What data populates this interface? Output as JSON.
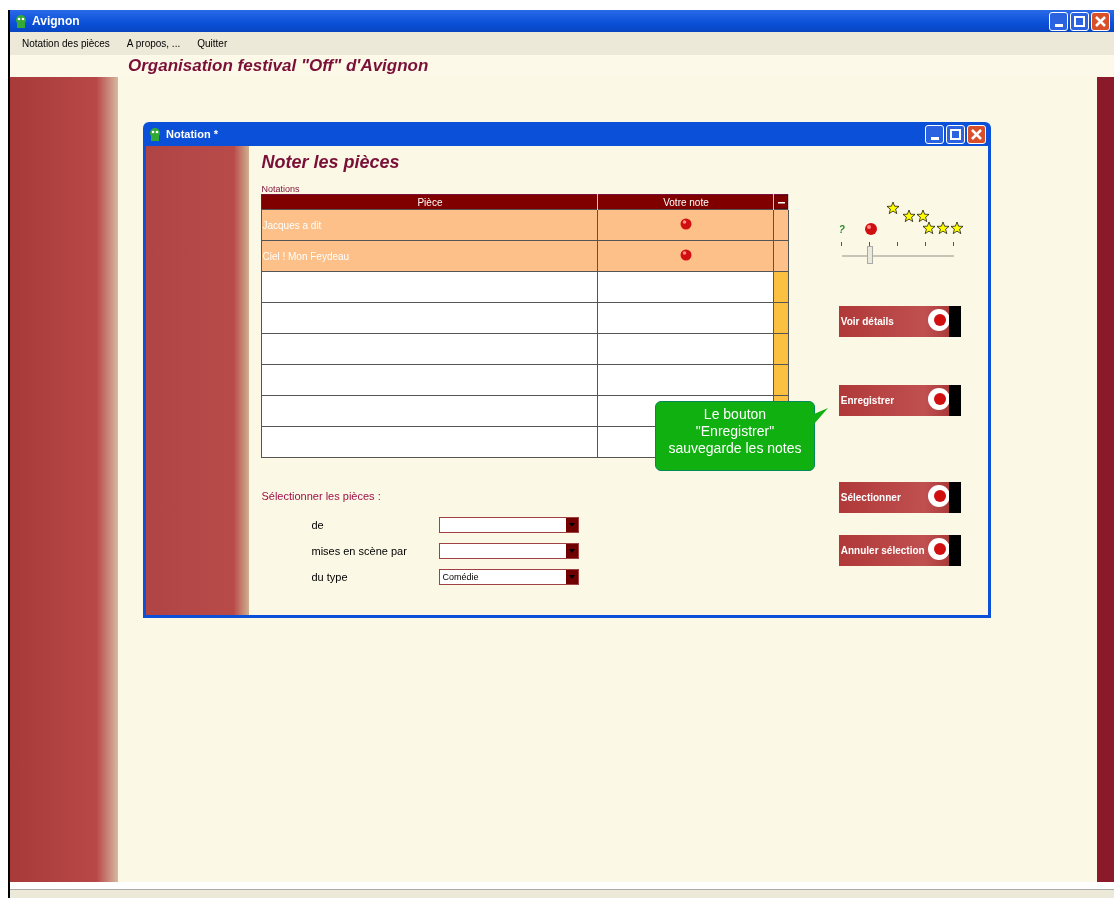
{
  "window": {
    "title": "Avignon"
  },
  "menu": [
    "Notation des pièces",
    "A propos, ...",
    "Quitter"
  ],
  "header": "Organisation festival \"Off\" d'Avignon",
  "dialog": {
    "title": "Notation *",
    "heading": "Noter les pièces",
    "table": {
      "label": "Notations",
      "columns": [
        "Pièce",
        "Votre note"
      ],
      "rows": [
        {
          "piece": "Jacques a dit"
        },
        {
          "piece": "Ciel ! Mon Feydeau"
        }
      ]
    },
    "rating": {
      "unknown": "?",
      "level": 0.25
    },
    "buttons": [
      "Voir détails",
      "Enregistrer",
      "Sélectionner",
      "Annuler sélection"
    ],
    "tooltip": "Le bouton \"Enregistrer\" sauvegarde les notes",
    "filter": {
      "title": "Sélectionner les pièces :",
      "fields": [
        {
          "label": "de"
        },
        {
          "label": "mises en scène par"
        },
        {
          "label": "du type",
          "value": "Comédie"
        }
      ]
    }
  }
}
